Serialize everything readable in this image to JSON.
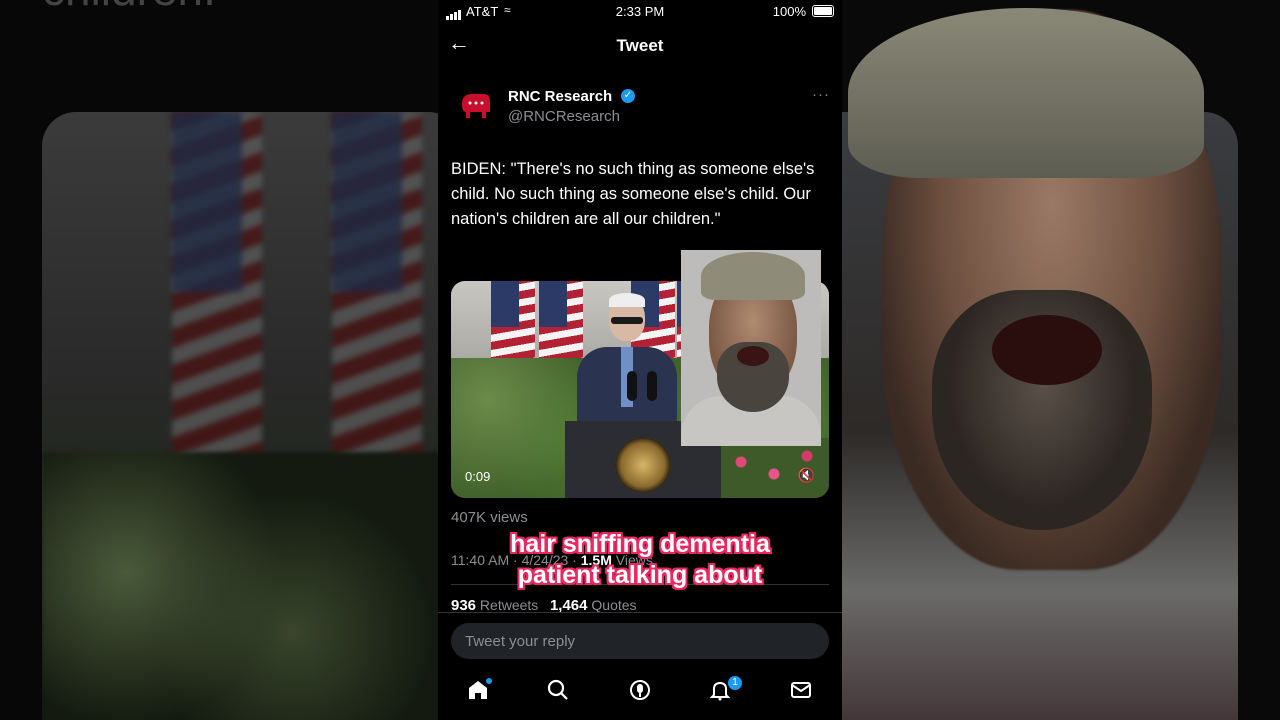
{
  "background_ghost_text": "children.",
  "status_bar": {
    "carrier": "AT&T",
    "time": "2:33 PM",
    "battery": "100%"
  },
  "header": {
    "title": "Tweet"
  },
  "tweet": {
    "author_name": "RNC Research",
    "author_handle": "@RNCResearch",
    "more": "···",
    "text": "BIDEN: \"There's no such thing as someone else's child. No such thing as someone else's child. Our nation's children are all our children.\"",
    "video_duration": "0:09",
    "views": "407K views",
    "time": "11:40 AM",
    "date": "4/24/23",
    "meta_views_count": "1.5M",
    "meta_views_label": "Views",
    "retweets_count": "936",
    "retweets_label": "Retweets",
    "quotes_count": "1,464",
    "quotes_label": "Quotes"
  },
  "reply": {
    "placeholder": "Tweet your reply"
  },
  "tab_bar": {
    "notifications_badge": "1"
  },
  "caption": {
    "line1": "hair sniffing dementia",
    "line2": "patient talking about"
  },
  "colors": {
    "accent": "#1d9bf0",
    "caption_outline": "#e8285f",
    "rnc_red": "#c8102e"
  },
  "icons": [
    "back-arrow-icon",
    "verified-icon",
    "more-icon",
    "mute-icon",
    "home-icon",
    "search-icon",
    "spaces-icon",
    "notifications-icon",
    "messages-icon"
  ]
}
